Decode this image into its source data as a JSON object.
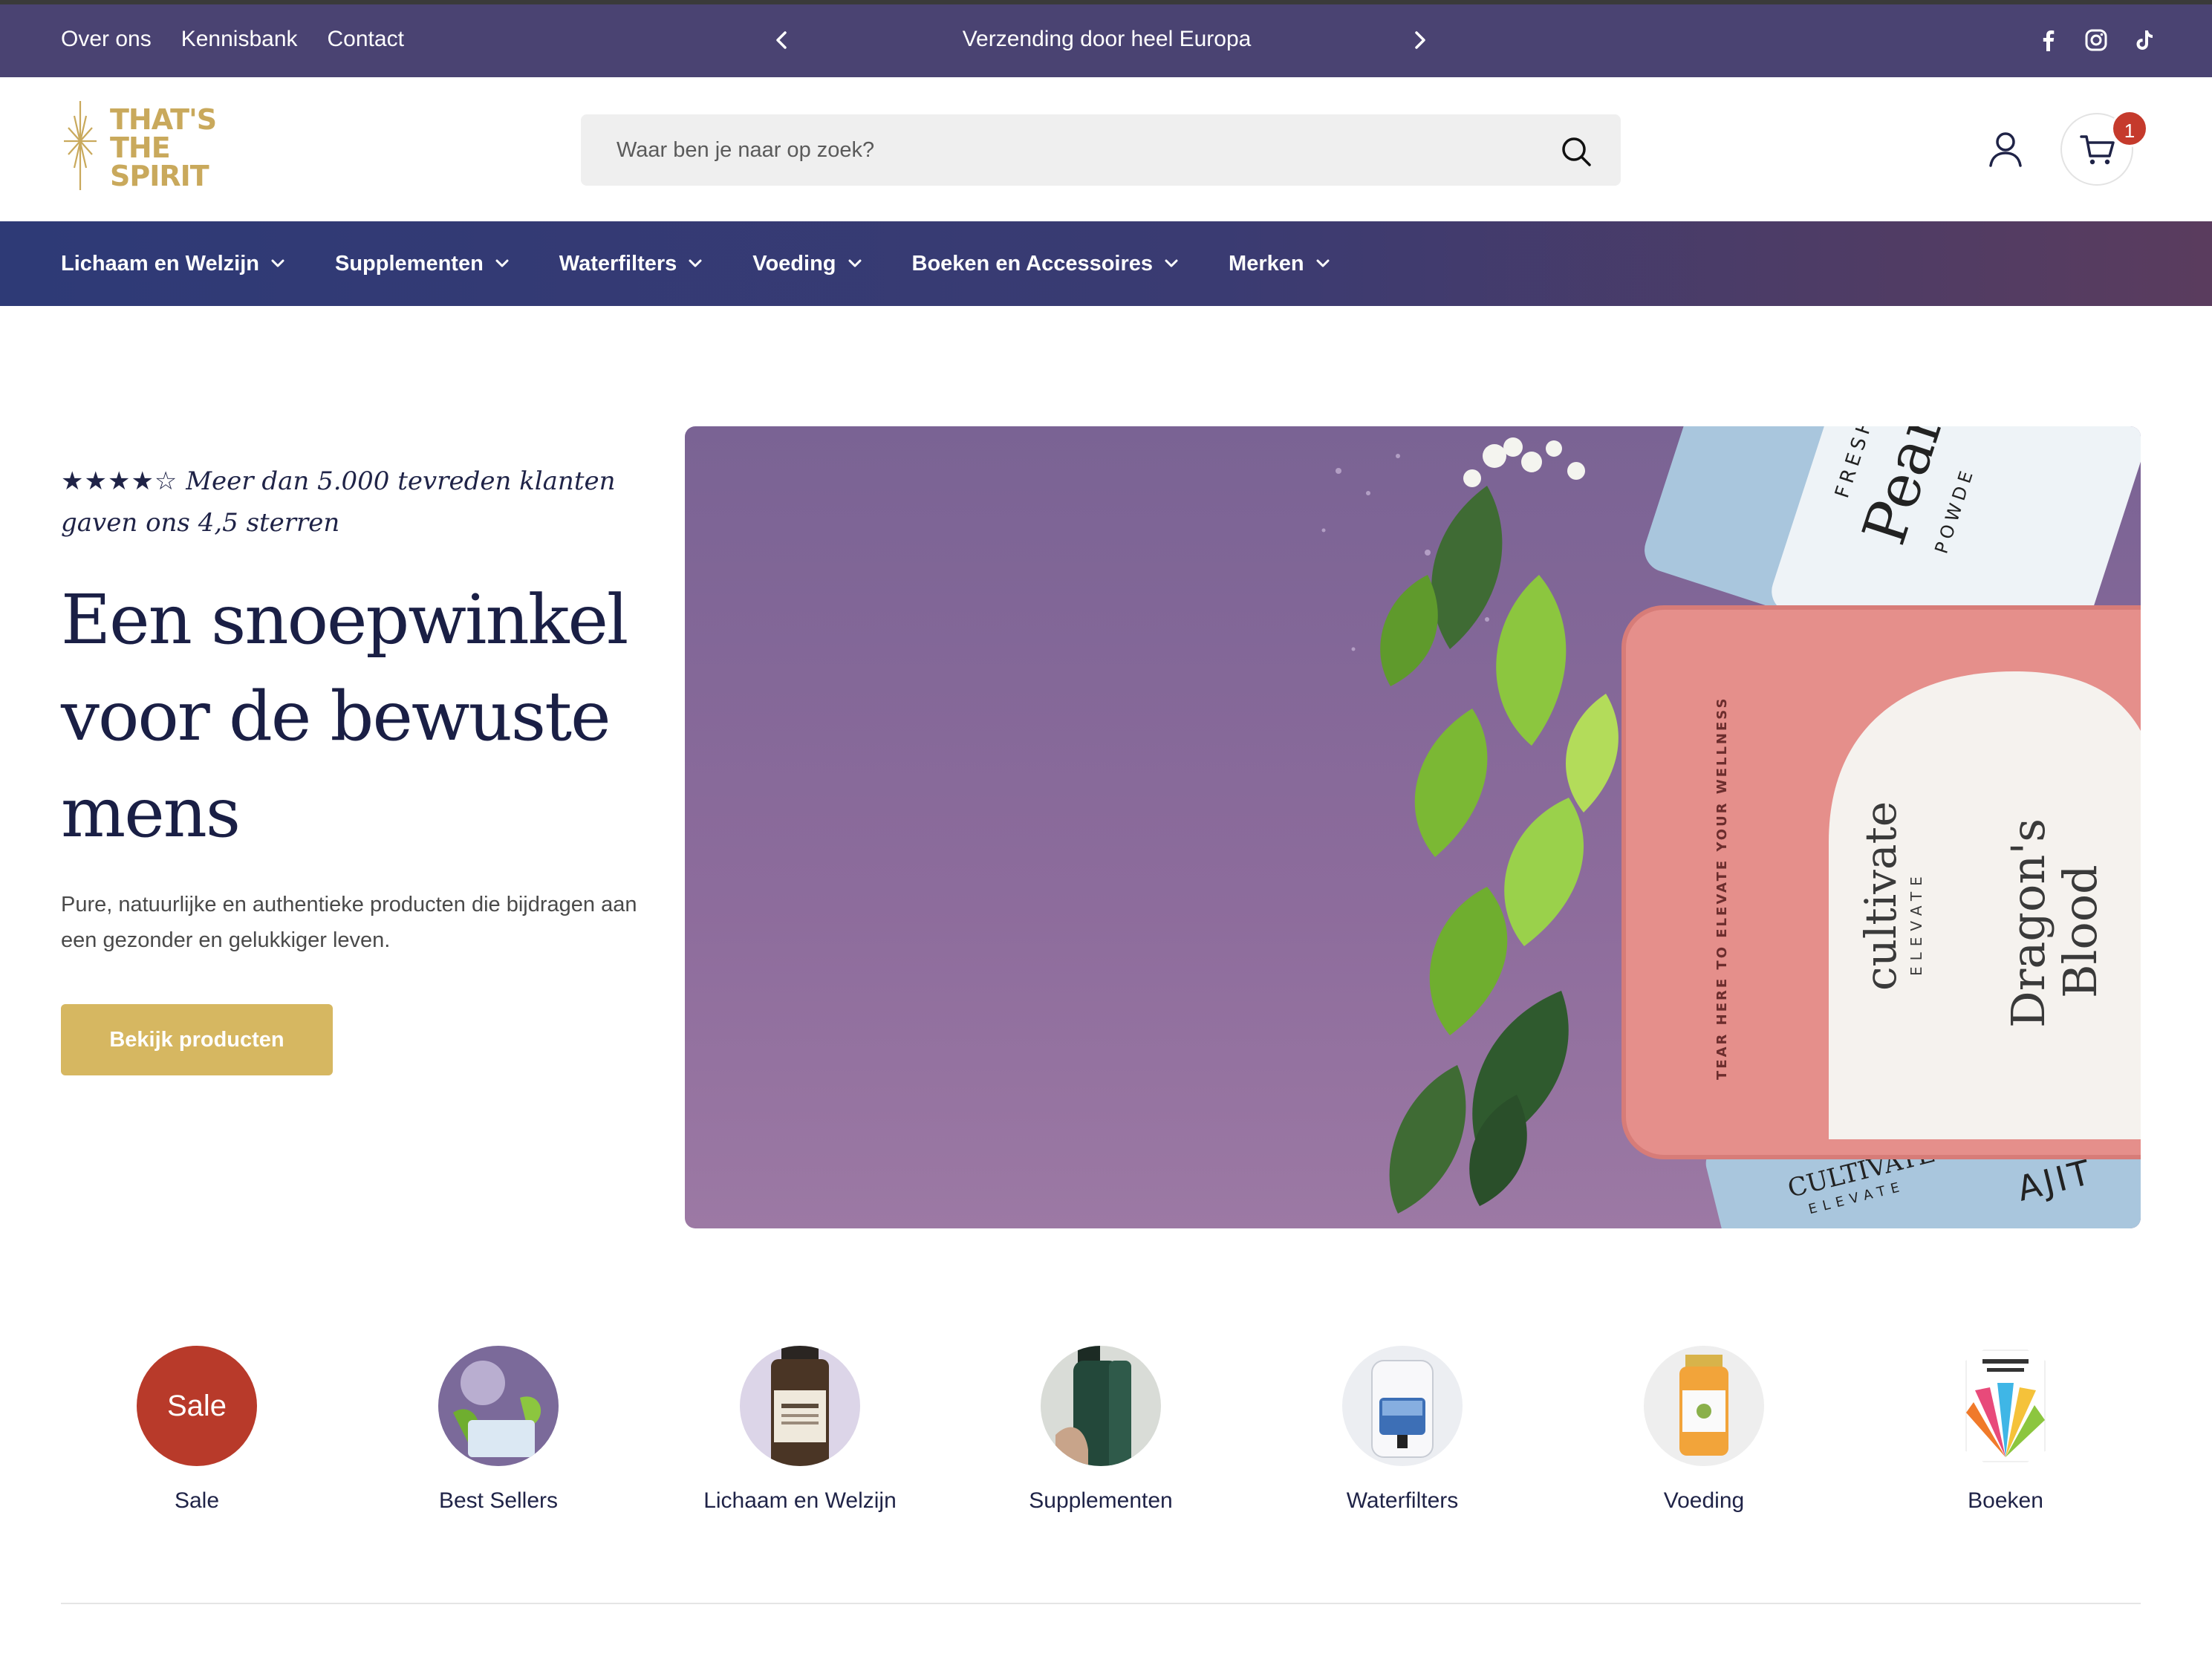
{
  "topbar": {
    "links": [
      "Over ons",
      "Kennisbank",
      "Contact"
    ],
    "announcement": "Verzending door heel Europa",
    "prev_icon": "chevron-left-icon",
    "next_icon": "chevron-right-icon",
    "socials": [
      "facebook-icon",
      "instagram-icon",
      "tiktok-icon"
    ]
  },
  "header": {
    "logo_lines": [
      "THAT'S",
      "THE",
      "SPIRIT"
    ],
    "search_placeholder": "Waar ben je naar op zoek?",
    "cart_count": "1"
  },
  "nav": {
    "items": [
      "Lichaam en Welzijn",
      "Supplementen",
      "Waterfilters",
      "Voeding",
      "Boeken en Accessoires",
      "Merken"
    ]
  },
  "hero": {
    "stars": "★★★★☆",
    "rating_text": "Meer dan 5.000 tevreden klanten gaven ons 4,5 sterren",
    "headline": "Een snoepwinkel voor de bewuste mens",
    "subcopy": "Pure, natuurlijke en authentieke producten die bijdragen aan een gezonder en gelukkiger leven.",
    "cta": "Bekijk producten",
    "image_texts": {
      "pearl_top": "FRESHWA",
      "pearl_big": "Pear",
      "pearl_small": "POWDE",
      "strip": "TEAR HERE TO ELEVATE YOUR WELLNESS",
      "brand": "cultivate",
      "brand_sub": "ELEVATE",
      "product": "Dragon's",
      "product2": "Blood",
      "bottom_brand": "CULTIVATE",
      "bottom_sub": "ELEVATE",
      "bottom_word": "AJIT"
    }
  },
  "categories": [
    {
      "label": "Sale",
      "circle_text": "Sale"
    },
    {
      "label": "Best Sellers"
    },
    {
      "label": "Lichaam en Welzijn"
    },
    {
      "label": "Supplementen"
    },
    {
      "label": "Waterfilters"
    },
    {
      "label": "Voeding"
    },
    {
      "label": "Boeken"
    }
  ],
  "colors": {
    "topbar": "#4a4372",
    "nav_start": "#2e3a76",
    "nav_end": "#5a3c5e",
    "accent_gold": "#d6b761",
    "sale_red": "#b83a2a",
    "badge_red": "#c53a2c"
  }
}
